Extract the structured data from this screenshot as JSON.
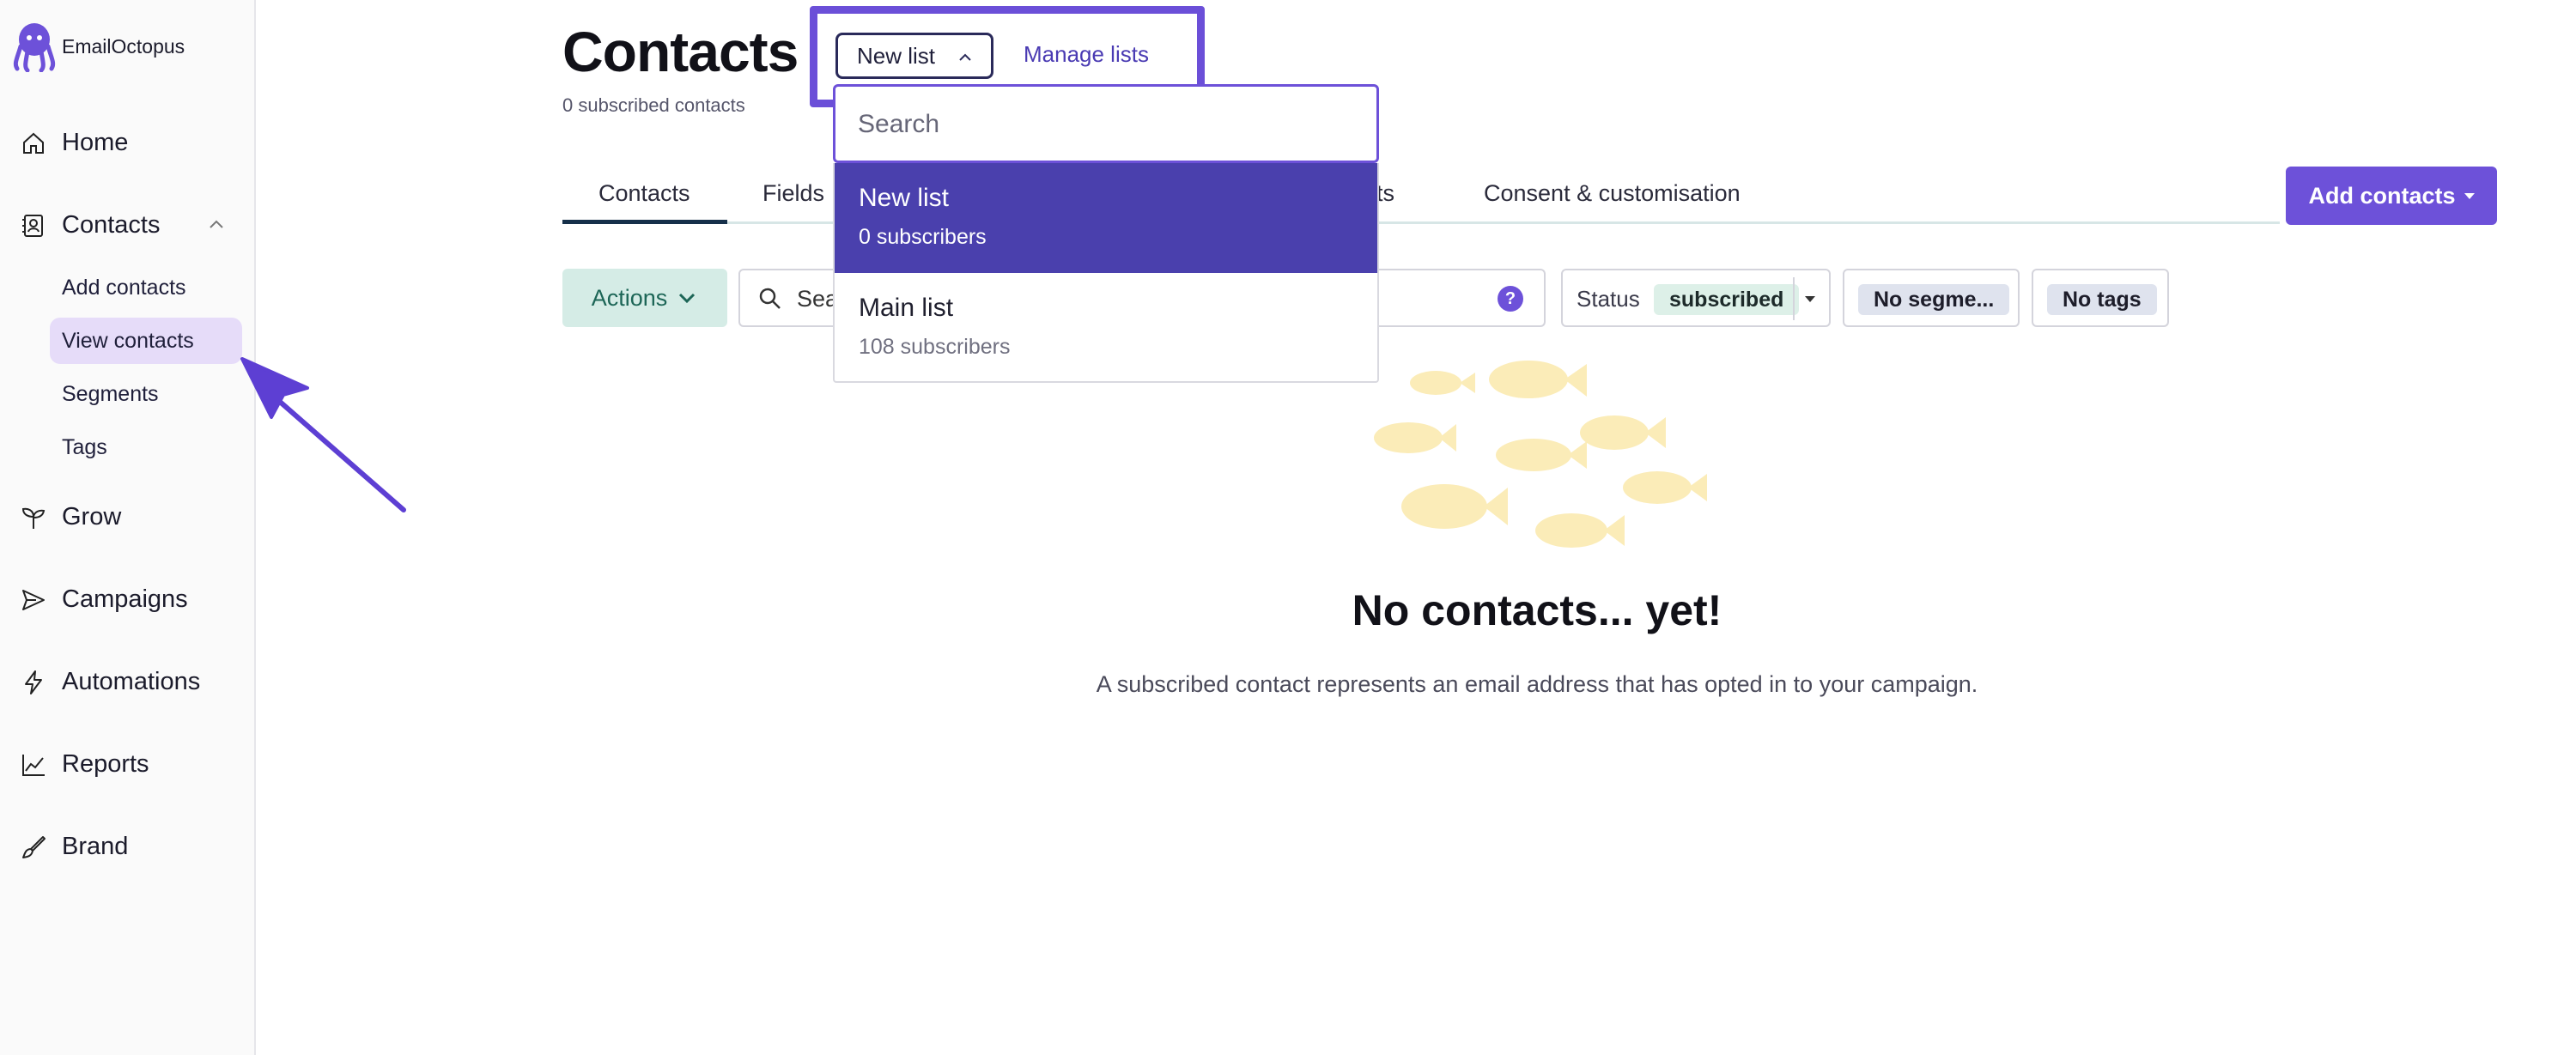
{
  "app": {
    "name": "EmailOctopus"
  },
  "colors": {
    "accent": "#6d51d9",
    "selected_row": "#4a40ad",
    "sidebar_active": "#e6dcf9",
    "fish": "#fbecb8"
  },
  "sidebar": {
    "items": [
      {
        "label": "Home",
        "icon": "home-icon"
      },
      {
        "label": "Contacts",
        "icon": "contacts-icon",
        "expanded": true
      },
      {
        "label": "Grow",
        "icon": "sprout-icon"
      },
      {
        "label": "Campaigns",
        "icon": "send-icon"
      },
      {
        "label": "Automations",
        "icon": "lightning-icon"
      },
      {
        "label": "Reports",
        "icon": "chart-icon"
      },
      {
        "label": "Brand",
        "icon": "brush-icon"
      }
    ],
    "contacts_sub": [
      {
        "label": "Add contacts"
      },
      {
        "label": "View contacts",
        "active": true
      },
      {
        "label": "Segments"
      },
      {
        "label": "Tags"
      }
    ]
  },
  "header": {
    "title": "Contacts",
    "subtitle": "0 subscribed contacts",
    "list_select": "New list",
    "manage_link": "Manage lists"
  },
  "tabs": [
    "Contacts",
    "Fields",
    "rts",
    "Consent & customisation"
  ],
  "add_contacts_label": "Add contacts",
  "filters": {
    "actions_label": "Actions",
    "search_value": "Sear",
    "status_label": "Status",
    "status_value": "subscribed",
    "segments_value": "No segme...",
    "tags_value": "No tags"
  },
  "dropdown": {
    "search_placeholder": "Search",
    "items": [
      {
        "name": "New list",
        "count": "0 subscribers",
        "selected": true
      },
      {
        "name": "Main list",
        "count": "108 subscribers",
        "selected": false
      }
    ]
  },
  "empty_state": {
    "title": "No contacts... yet!",
    "description": "A subscribed contact represents an email address that has opted in to your campaign."
  }
}
